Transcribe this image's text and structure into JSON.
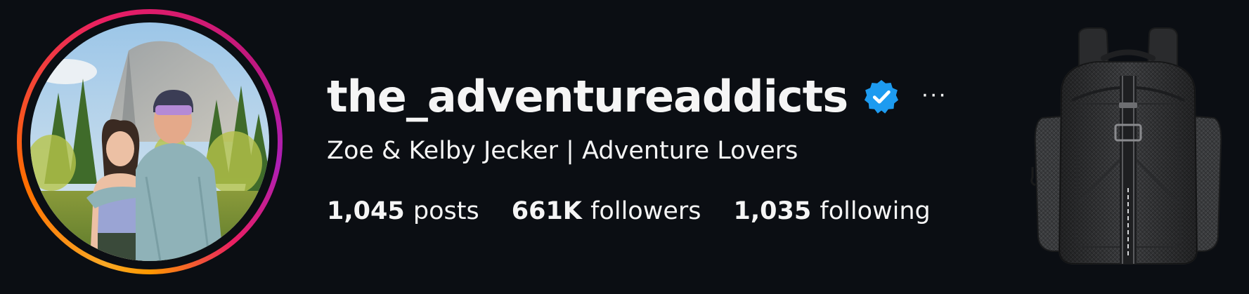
{
  "profile": {
    "username": "the_adventureaddicts",
    "verified": true,
    "more_glyph": "···",
    "bio": "Zoe & Kelby Jecker | Adventure Lovers",
    "avatar_icon": "profile-photo",
    "story_ring": true
  },
  "stats": {
    "posts_count": "1,045",
    "posts_label": "posts",
    "followers_count": "661K",
    "followers_label": "followers",
    "following_count": "1,035",
    "following_label": "following"
  },
  "product_image": {
    "icon": "backpack-image"
  },
  "colors": {
    "background": "#0b0e13",
    "text": "#f5f5f5",
    "verified_blue": "#1d9bf0",
    "ring_start": "#f9a825",
    "ring_mid": "#e91e63",
    "ring_end": "#ad1fb6"
  }
}
